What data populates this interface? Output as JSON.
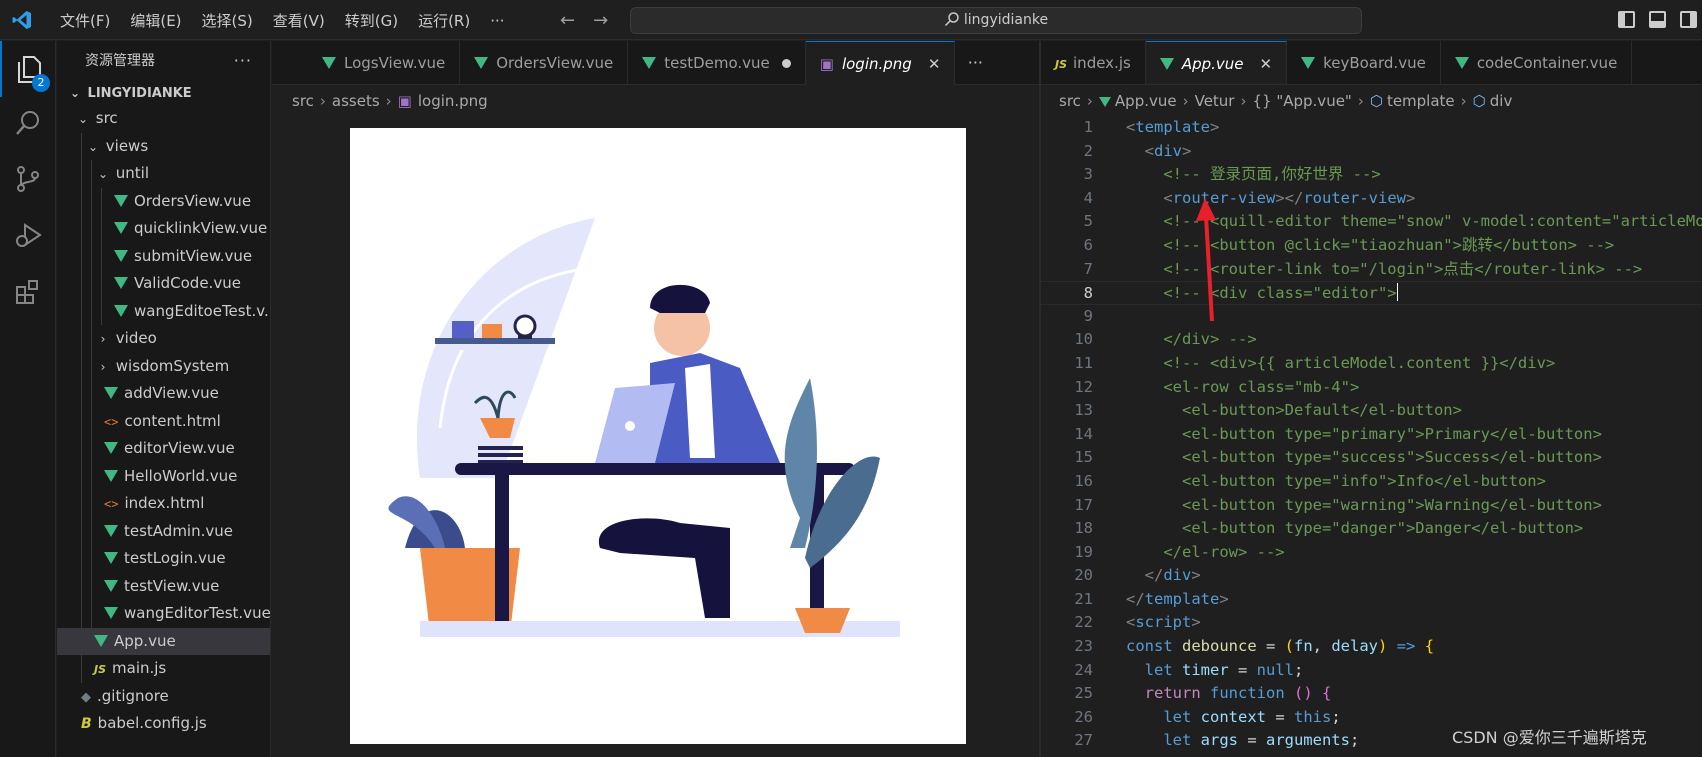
{
  "menu": [
    "文件(F)",
    "编辑(E)",
    "选择(S)",
    "查看(V)",
    "转到(G)",
    "运行(R)",
    "···"
  ],
  "search": {
    "text": "lingyidianke"
  },
  "activity_badge": "2",
  "sidebar": {
    "title": "资源管理器",
    "more": "···",
    "root": "LINGYIDIANKE",
    "items": [
      {
        "label": "src"
      },
      {
        "label": "views"
      },
      {
        "label": "until"
      },
      {
        "label": "OrdersView.vue"
      },
      {
        "label": "quicklinkView.vue"
      },
      {
        "label": "submitView.vue"
      },
      {
        "label": "ValidCode.vue"
      },
      {
        "label": "wangEditoeTest.v..."
      },
      {
        "label": "video"
      },
      {
        "label": "wisdomSystem"
      },
      {
        "label": "addView.vue"
      },
      {
        "label": "content.html"
      },
      {
        "label": "editorView.vue"
      },
      {
        "label": "HelloWorld.vue"
      },
      {
        "label": "index.html"
      },
      {
        "label": "testAdmin.vue"
      },
      {
        "label": "testLogin.vue"
      },
      {
        "label": "testView.vue"
      },
      {
        "label": "wangEditorTest.vue"
      },
      {
        "label": "App.vue"
      },
      {
        "label": "main.js"
      },
      {
        "label": ".gitignore"
      },
      {
        "label": "babel.config.js"
      }
    ]
  },
  "group1": {
    "tabs": [
      {
        "label": "LogsView.vue"
      },
      {
        "label": "OrdersView.vue"
      },
      {
        "label": "testDemo.vue"
      },
      {
        "label": "login.png"
      }
    ],
    "more": "···",
    "breadcrumb": [
      "src",
      "assets",
      "login.png"
    ]
  },
  "group2": {
    "tabs": [
      {
        "label": "index.js",
        "icon": "JS"
      },
      {
        "label": "App.vue"
      },
      {
        "label": "keyBoard.vue"
      },
      {
        "label": "codeContainer.vue"
      }
    ],
    "breadcrumb": [
      "src",
      "App.vue",
      "Vetur",
      "{} \"App.vue\"",
      "template",
      "div"
    ]
  },
  "code": {
    "line_numbers": [
      "1",
      "2",
      "3",
      "4",
      "5",
      "6",
      "7",
      "8",
      "9",
      "10",
      "11",
      "12",
      "13",
      "14",
      "15",
      "16",
      "17",
      "18",
      "19",
      "20",
      "21",
      "22",
      "23",
      "24",
      "25",
      "26",
      "27"
    ],
    "current_line": "8",
    "lines": [
      [
        [
          "t-punc",
          "<"
        ],
        [
          "t-tag",
          "template"
        ],
        [
          "t-punc",
          ">"
        ]
      ],
      [
        [
          "t-txt",
          "  "
        ],
        [
          "t-punc",
          "<"
        ],
        [
          "t-tag",
          "div"
        ],
        [
          "t-punc",
          ">"
        ]
      ],
      [
        [
          "t-txt",
          "    "
        ],
        [
          "t-com",
          "<!-- 登录页面,你好世界 -->"
        ]
      ],
      [
        [
          "t-txt",
          "    "
        ],
        [
          "t-punc",
          "<"
        ],
        [
          "t-tag",
          "router-view"
        ],
        [
          "t-punc",
          "></"
        ],
        [
          "t-tag",
          "router-view"
        ],
        [
          "t-punc",
          ">"
        ]
      ],
      [
        [
          "t-txt",
          "    "
        ],
        [
          "t-com",
          "<!-- <quill-editor theme=\"snow\" v-model:content=\"articleModel.content\" -->"
        ]
      ],
      [
        [
          "t-txt",
          "    "
        ],
        [
          "t-com",
          "<!-- <button @click=\"tiaozhuan\">跳转</button> -->"
        ]
      ],
      [
        [
          "t-txt",
          "    "
        ],
        [
          "t-com",
          "<!-- <router-link to=\"/login\">点击</router-link> -->"
        ]
      ],
      [
        [
          "t-txt",
          "    "
        ],
        [
          "t-com",
          "<!-- <div class=\"editor\">"
        ]
      ],
      [],
      [
        [
          "t-txt",
          "    "
        ],
        [
          "t-com",
          "</div> -->"
        ]
      ],
      [
        [
          "t-txt",
          "    "
        ],
        [
          "t-com",
          "<!-- <div>{{ articleModel.content }}</div>"
        ]
      ],
      [
        [
          "t-txt",
          "    "
        ],
        [
          "t-com",
          "<el-row class=\"mb-4\">"
        ]
      ],
      [
        [
          "t-txt",
          "      "
        ],
        [
          "t-com",
          "<el-button>Default</el-button>"
        ]
      ],
      [
        [
          "t-txt",
          "      "
        ],
        [
          "t-com",
          "<el-button type=\"primary\">Primary</el-button>"
        ]
      ],
      [
        [
          "t-txt",
          "      "
        ],
        [
          "t-com",
          "<el-button type=\"success\">Success</el-button>"
        ]
      ],
      [
        [
          "t-txt",
          "      "
        ],
        [
          "t-com",
          "<el-button type=\"info\">Info</el-button>"
        ]
      ],
      [
        [
          "t-txt",
          "      "
        ],
        [
          "t-com",
          "<el-button type=\"warning\">Warning</el-button>"
        ]
      ],
      [
        [
          "t-txt",
          "      "
        ],
        [
          "t-com",
          "<el-button type=\"danger\">Danger</el-button>"
        ]
      ],
      [
        [
          "t-txt",
          "    "
        ],
        [
          "t-com",
          "</el-row> -->"
        ]
      ],
      [
        [
          "t-txt",
          "  "
        ],
        [
          "t-punc",
          "</"
        ],
        [
          "t-tag",
          "div"
        ],
        [
          "t-punc",
          ">"
        ]
      ],
      [
        [
          "t-punc",
          "</"
        ],
        [
          "t-tag",
          "template"
        ],
        [
          "t-punc",
          ">"
        ]
      ],
      [
        [
          "t-punc",
          "<"
        ],
        [
          "t-tag",
          "script"
        ],
        [
          "t-punc",
          ">"
        ]
      ],
      [
        [
          "t-kw",
          "const "
        ],
        [
          "t-fn",
          "debounce"
        ],
        [
          "t-txt",
          " = "
        ],
        [
          "t-br1",
          "("
        ],
        [
          "t-var",
          "fn"
        ],
        [
          "t-txt",
          ", "
        ],
        [
          "t-var",
          "delay"
        ],
        [
          "t-br1",
          ")"
        ],
        [
          "t-kw",
          " => "
        ],
        [
          "t-br1",
          "{"
        ]
      ],
      [
        [
          "t-txt",
          "  "
        ],
        [
          "t-kw",
          "let "
        ],
        [
          "t-var",
          "timer"
        ],
        [
          "t-txt",
          " = "
        ],
        [
          "t-kw",
          "null"
        ],
        [
          "t-txt",
          ";"
        ]
      ],
      [
        [
          "t-txt",
          "  "
        ],
        [
          "t-kw2",
          "return "
        ],
        [
          "t-kw",
          "function "
        ],
        [
          "t-br2",
          "()"
        ],
        [
          "t-txt",
          " "
        ],
        [
          "t-br2",
          "{"
        ]
      ],
      [
        [
          "t-txt",
          "    "
        ],
        [
          "t-kw",
          "let "
        ],
        [
          "t-var",
          "context"
        ],
        [
          "t-txt",
          " = "
        ],
        [
          "t-kw",
          "this"
        ],
        [
          "t-txt",
          ";"
        ]
      ],
      [
        [
          "t-txt",
          "    "
        ],
        [
          "t-kw",
          "let "
        ],
        [
          "t-var",
          "args"
        ],
        [
          "t-txt",
          " = "
        ],
        [
          "t-var",
          "arguments"
        ],
        [
          "t-txt",
          ";"
        ]
      ]
    ]
  },
  "watermark": "CSDN @爱你三千遍斯塔克",
  "colors": {
    "accent": "#0078d4",
    "vue_green": "#41b883",
    "arrow_red": "#e8202a"
  }
}
